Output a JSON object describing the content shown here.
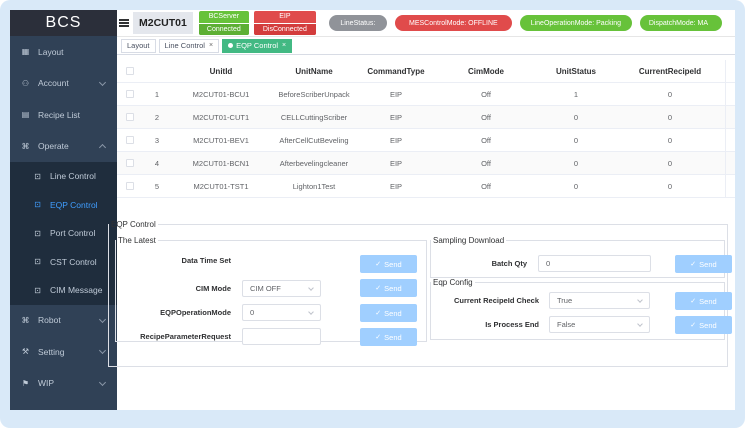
{
  "app": {
    "logo": "BCS"
  },
  "sidebar": {
    "items": [
      {
        "label": "Layout",
        "icon": "layout-icon",
        "glyph": "▦",
        "expandable": false
      },
      {
        "label": "Account",
        "icon": "account-icon",
        "glyph": "⚇",
        "expandable": true
      },
      {
        "label": "Recipe List",
        "icon": "recipe-icon",
        "glyph": "▤",
        "expandable": false
      },
      {
        "label": "Operate",
        "icon": "operate-icon",
        "glyph": "⌘",
        "expandable": true,
        "open": true
      }
    ],
    "operate_sub": [
      {
        "label": "Line Control",
        "icon": "line-control-icon",
        "glyph": "⊡",
        "active": false
      },
      {
        "label": "EQP Control",
        "icon": "eqp-control-icon",
        "glyph": "⊡",
        "active": true
      },
      {
        "label": "Port Control",
        "icon": "port-control-icon",
        "glyph": "⊡",
        "active": false
      },
      {
        "label": "CST Control",
        "icon": "cst-control-icon",
        "glyph": "⊡",
        "active": false
      },
      {
        "label": "CIM Message",
        "icon": "cim-message-icon",
        "glyph": "⊡",
        "active": false
      }
    ],
    "bottom_items": [
      {
        "label": "Robot",
        "icon": "robot-icon",
        "glyph": "⌘",
        "expandable": true
      },
      {
        "label": "Setting",
        "icon": "setting-icon",
        "glyph": "⚒",
        "expandable": true
      },
      {
        "label": "WIP",
        "icon": "wip-icon",
        "glyph": "⚑",
        "expandable": true
      }
    ]
  },
  "header": {
    "line_name": "M2CUT01",
    "bcserver": {
      "top": "BCServer",
      "bottom": "Connected",
      "color": "#67c23a"
    },
    "eip": {
      "top": "EIP",
      "bottom": "DisConnected",
      "color": "#e04b4b"
    },
    "line_status": "LineStatus:",
    "mes_mode": "MESControlMode: OFFLINE",
    "line_op_mode": "LineOperationMode: Packing",
    "dispatch_mode": "DispatchMode: MA"
  },
  "tags": [
    {
      "label": "Layout",
      "closable": false,
      "active": false
    },
    {
      "label": "Line Control",
      "closable": true,
      "active": false
    },
    {
      "label": "EQP Control",
      "closable": true,
      "active": true
    }
  ],
  "table": {
    "columns": [
      "",
      "",
      "UnitId",
      "UnitName",
      "CommandType",
      "CimMode",
      "UnitStatus",
      "CurrentRecipeId"
    ],
    "rows": [
      {
        "idx": "1",
        "unit_id": "M2CUT01-BCU1",
        "unit_name": "BeforeScriberUnpack",
        "command_type": "EIP",
        "cim_mode": "Off",
        "unit_status": "1",
        "recipe_id": "0"
      },
      {
        "idx": "2",
        "unit_id": "M2CUT01-CUT1",
        "unit_name": "CELLCuttingScriber",
        "command_type": "EIP",
        "cim_mode": "Off",
        "unit_status": "0",
        "recipe_id": "0"
      },
      {
        "idx": "3",
        "unit_id": "M2CUT01-BEV1",
        "unit_name": "AfterCellCutBeveling",
        "command_type": "EIP",
        "cim_mode": "Off",
        "unit_status": "0",
        "recipe_id": "0"
      },
      {
        "idx": "4",
        "unit_id": "M2CUT01-BCN1",
        "unit_name": "Afterbevelingcleaner",
        "command_type": "EIP",
        "cim_mode": "Off",
        "unit_status": "0",
        "recipe_id": "0"
      },
      {
        "idx": "5",
        "unit_id": "M2CUT01-TST1",
        "unit_name": "Lighton1Test",
        "command_type": "EIP",
        "cim_mode": "Off",
        "unit_status": "0",
        "recipe_id": "0"
      }
    ]
  },
  "eqp_control": {
    "title": "EQP Control",
    "latest": {
      "title": "The Latest",
      "data_time_set_label": "Data Time Set",
      "cim_mode_label": "CIM Mode",
      "cim_mode_value": "CIM OFF",
      "eqp_op_mode_label": "EQPOperationMode",
      "eqp_op_mode_value": "0",
      "recipe_param_label": "RecipeParameterRequest",
      "recipe_param_value": "",
      "send_label": "Send"
    },
    "sampling": {
      "title": "Sampling Download",
      "batch_qty_label": "Batch Qty",
      "batch_qty_value": "0",
      "send_label": "Send"
    },
    "config": {
      "title": "Eqp Config",
      "current_recipe_check_label": "Current RecipeId Check",
      "current_recipe_check_value": "True",
      "is_process_end_label": "Is Process End",
      "is_process_end_value": "False",
      "send_label": "Send"
    }
  }
}
